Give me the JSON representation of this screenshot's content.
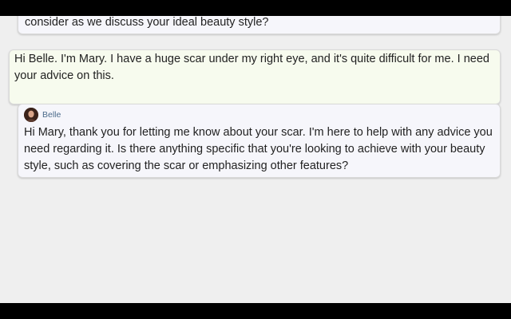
{
  "chat": {
    "messages": [
      {
        "role": "assistant",
        "text": "consider as we discuss your ideal beauty style?"
      },
      {
        "role": "user",
        "text": "Hi Belle. I'm Mary. I have a huge scar under my right eye, and it's quite difficult for me. I need your advice on this."
      },
      {
        "role": "assistant",
        "sender": "Belle",
        "avatar_icon": "avatar-icon",
        "text": "Hi Mary, thank you for letting me know about your scar. I'm here to help with any advice you need regarding it. Is there anything specific that you're looking to achieve with your beauty style, such as covering the scar or emphasizing other features?"
      }
    ]
  },
  "colors": {
    "assistant_bubble": "#f6f6fb",
    "user_bubble": "#f7fbee",
    "sender_name": "#4a6a8a",
    "background": "#efefef"
  }
}
